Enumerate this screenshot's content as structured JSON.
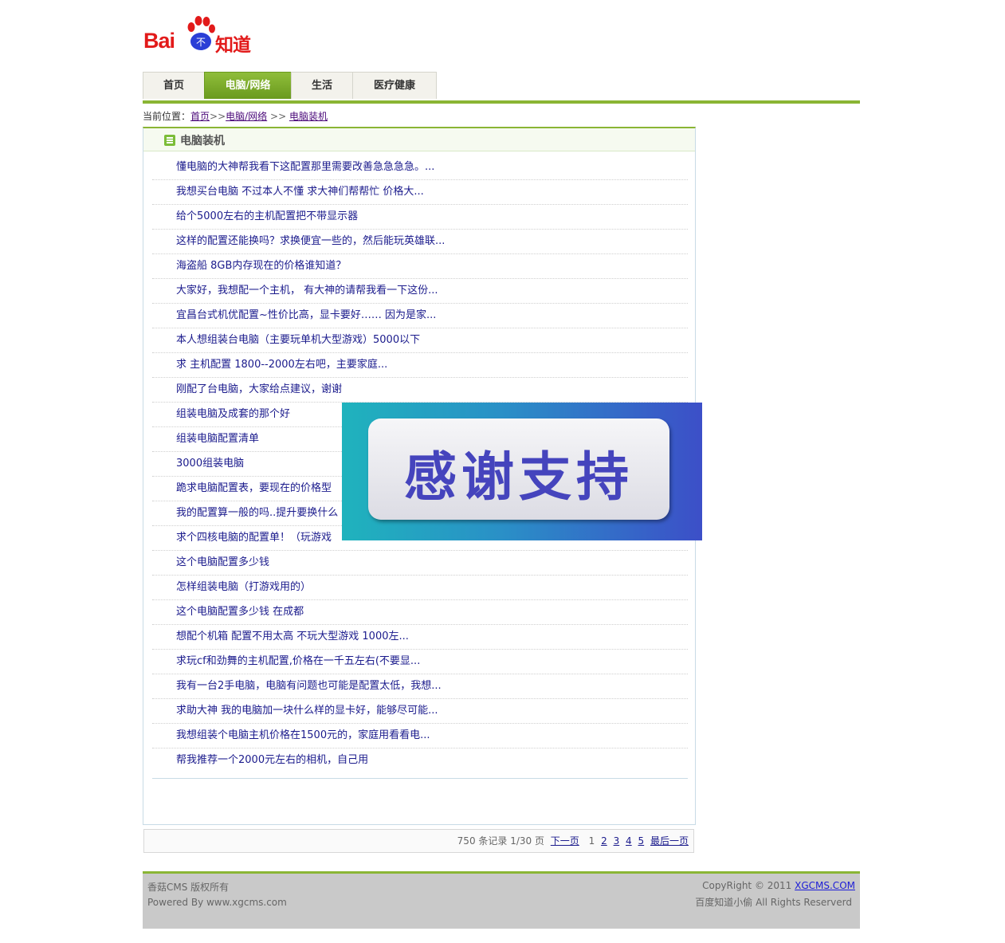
{
  "logo": {
    "latin": "Bai",
    "paw_text": "不",
    "cn": "知道"
  },
  "nav": {
    "tabs": [
      {
        "label": "首页",
        "active": false
      },
      {
        "label": "电脑/网络",
        "active": true
      },
      {
        "label": "生活",
        "active": false
      },
      {
        "label": "医疗健康",
        "active": false
      }
    ]
  },
  "breadcrumb": {
    "prefix": "当前位置：",
    "home": "首页",
    "sep1": ">>",
    "cat": "电脑/网络",
    "sep2": ">>",
    "sub": "电脑装机"
  },
  "section": {
    "title": "电脑装机"
  },
  "questions": [
    "懂电脑的大神帮我看下这配置那里需要改善急急急急。...",
    "我想买台电脑 不过本人不懂 求大神们帮帮忙 价格大...",
    "给个5000左右的主机配置把不带显示器",
    "这样的配置还能换吗？求换便宜一些的，然后能玩英雄联...",
    "海盗船 8GB内存现在的价格谁知道？",
    "大家好，我想配一个主机， 有大神的请帮我看一下这份...",
    "宜昌台式机优配置~性价比高，显卡要好…… 因为是家...",
    "本人想组装台电脑（主要玩单机大型游戏）5000以下",
    "求 主机配置 1800--2000左右吧，主要家庭...",
    "刚配了台电脑，大家给点建议，谢谢",
    "组装电脑及成套的那个好",
    "组装电脑配置清单",
    "3000组装电脑",
    "跪求电脑配置表，要现在的价格型",
    "我的配置算一般的吗..提升要换什么",
    "求个四核电脑的配置单！（玩游戏",
    "这个电脑配置多少钱",
    "怎样组装电脑（打游戏用的）",
    "这个电脑配置多少钱 在成都",
    "想配个机箱 配置不用太高 不玩大型游戏 1000左...",
    "求玩cf和劲舞的主机配置,价格在一千五左右(不要显...",
    "我有一台2手电脑，电脑有问题也可能是配置太低，我想...",
    "求助大神 我的电脑加一块什么样的显卡好，能够尽可能...",
    "我想组装个电脑主机价格在1500元的，家庭用看看电...",
    "帮我推荐一个2000元左右的相机，自己用"
  ],
  "pager": {
    "summary": "750 条记录 1/30 页",
    "next": "下一页",
    "current": "1",
    "pages": [
      "2",
      "3",
      "4",
      "5"
    ],
    "last": "最后一页"
  },
  "overlay": {
    "text": "感谢支持"
  },
  "footer": {
    "left1": "香菇CMS 版权所有",
    "left2": "Powered By www.xgcms.com",
    "right_prefix": "CopyRight © 2011 ",
    "right_link": "XGCMS.COM",
    "right2": "百度知道小偷 All Rights Reserverd"
  },
  "colors": {
    "accent_green": "#8ab534",
    "link_blue": "#1a1a8c",
    "logo_red": "#e21a1a",
    "logo_blue": "#2b3fd6"
  }
}
